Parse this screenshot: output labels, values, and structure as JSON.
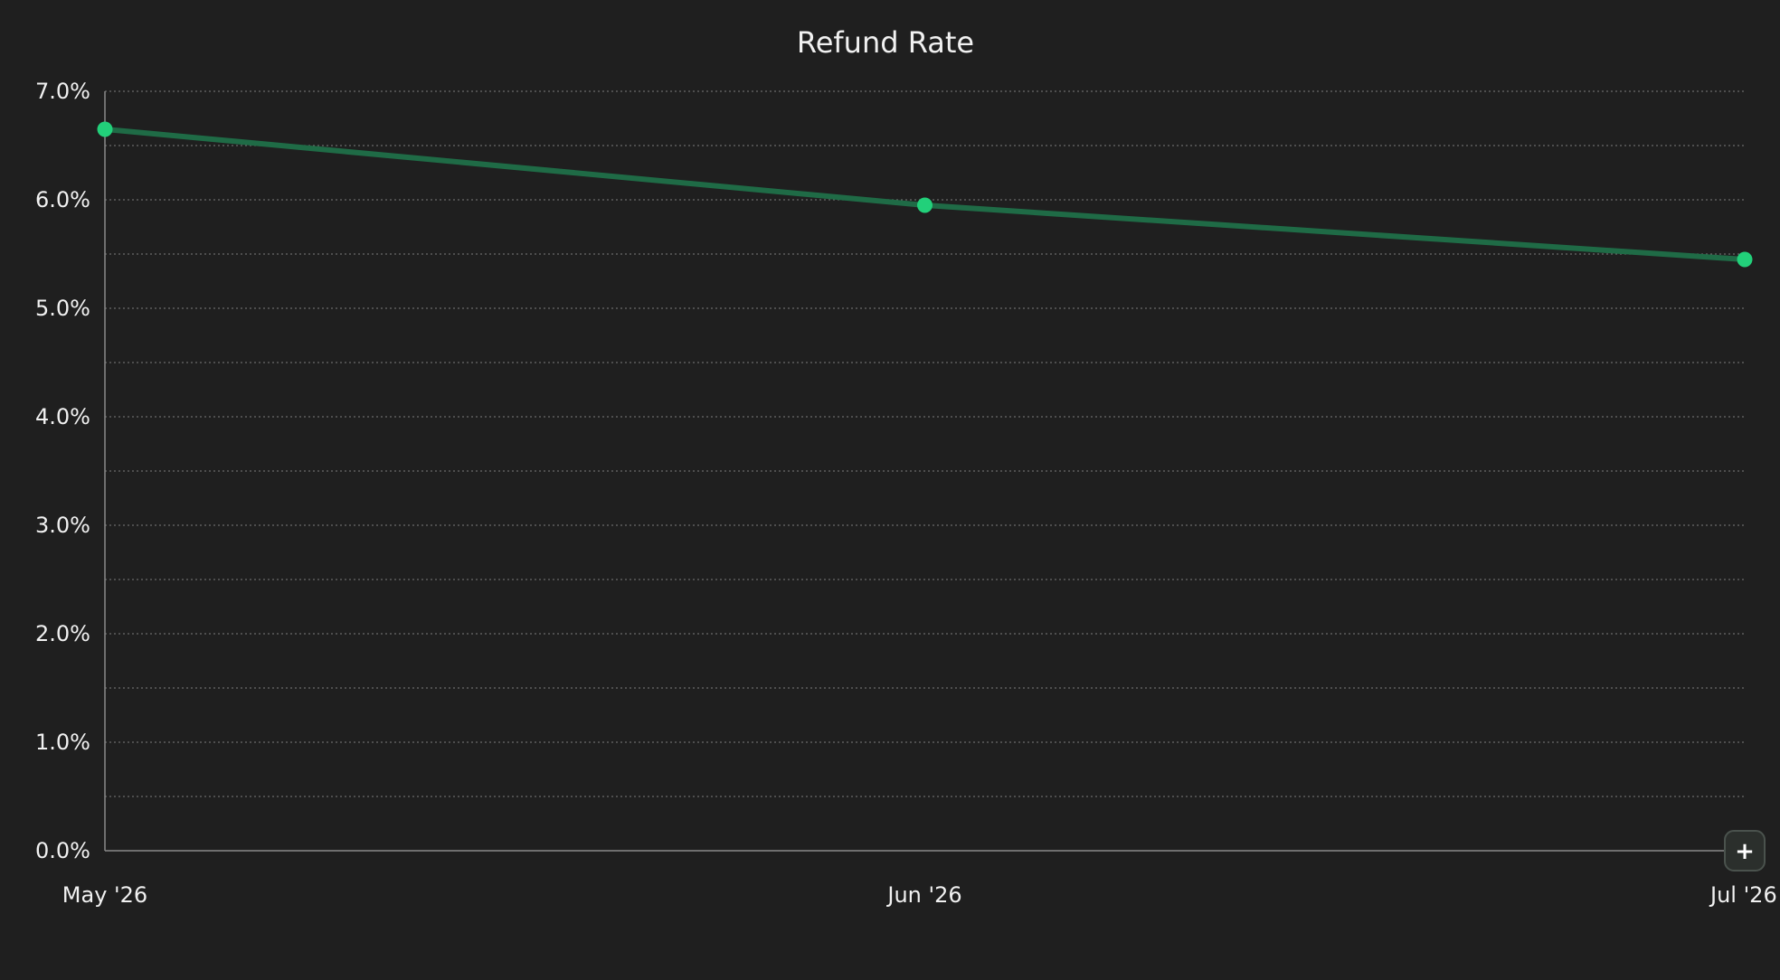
{
  "chart_data": {
    "type": "line",
    "title": "Refund Rate",
    "xlabel": "",
    "ylabel": "",
    "categories": [
      "May '26",
      "Jun '26",
      "Jul '26"
    ],
    "series": [
      {
        "values": [
          6.65,
          5.95,
          5.45
        ]
      }
    ],
    "ylim": [
      0,
      7
    ],
    "y_ticks": [
      "0.0%",
      "1.0%",
      "2.0%",
      "3.0%",
      "4.0%",
      "5.0%",
      "6.0%",
      "7.0%"
    ],
    "grid": true,
    "colors": {
      "background": "#1f1f1f",
      "line": "#1f6b46",
      "marker": "#22d07a",
      "grid": "#6a6a6a",
      "axis": "#8a8a8a",
      "text": "#f1f1f1"
    }
  },
  "controls": {
    "zoom_label": "+",
    "zoom_icon": "plus-icon"
  }
}
